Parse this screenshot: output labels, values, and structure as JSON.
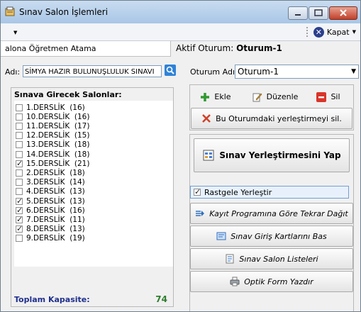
{
  "window": {
    "title": "Sınav Salon İşlemleri"
  },
  "toolbar": {
    "close_label": "Kapat"
  },
  "tabs": {
    "left_label": "alona Öğretmen Atama",
    "active_session_label": "Aktif Oturum:",
    "active_session_value": "Oturum-1"
  },
  "left": {
    "name_label": "Adı:",
    "exam_name": "SİMYA HAZIR BULUNUŞLULUK SINAVI",
    "salonlar_title": "Sınava Girecek Salonlar:",
    "salonlar": [
      {
        "label": "1.DERSLİK  (16)",
        "checked": false
      },
      {
        "label": "10.DERSLİK  (16)",
        "checked": false
      },
      {
        "label": "11.DERSLİK  (17)",
        "checked": false
      },
      {
        "label": "12.DERSLİK  (15)",
        "checked": false
      },
      {
        "label": "13.DERSLİK  (18)",
        "checked": false
      },
      {
        "label": "14.DERSLİK  (18)",
        "checked": false
      },
      {
        "label": "15.DERSLİK  (21)",
        "checked": true
      },
      {
        "label": "2.DERSLİK  (18)",
        "checked": false
      },
      {
        "label": "3.DERSLİK  (14)",
        "checked": false
      },
      {
        "label": "4.DERSLİK  (13)",
        "checked": false
      },
      {
        "label": "5.DERSLİK  (13)",
        "checked": true
      },
      {
        "label": "6.DERSLİK  (16)",
        "checked": true
      },
      {
        "label": "7.DERSLİK  (11)",
        "checked": true
      },
      {
        "label": "8.DERSLİK  (13)",
        "checked": true
      },
      {
        "label": "9.DERSLİK  (19)",
        "checked": false
      }
    ],
    "capacity_label": "Toplam Kapasite:",
    "capacity_value": "74"
  },
  "right": {
    "session_name_label": "Oturum Adı:",
    "session_name_value": "Oturum-1",
    "add_label": "Ekle",
    "edit_label": "Düzenle",
    "delete_label": "Sil",
    "clear_label": "Bu Oturumdaki yerleştirmeyi sil.",
    "place_label": "Sınav Yerleştirmesini Yap",
    "random_label": "Rastgele Yerleştir",
    "random_checked": true,
    "reorder_label": "Kayıt Programına Göre Tekrar Dağıt",
    "cards_label": "Sınav Giriş Kartlarını Bas",
    "lists_label": "Sınav Salon Listeleri",
    "optik_label": "Optik Form Yazdır"
  },
  "colors": {
    "capacity_label": "#1f2f8c",
    "capacity_value": "#2e7d2e",
    "close_icon_bg": "#2c3f8c"
  }
}
